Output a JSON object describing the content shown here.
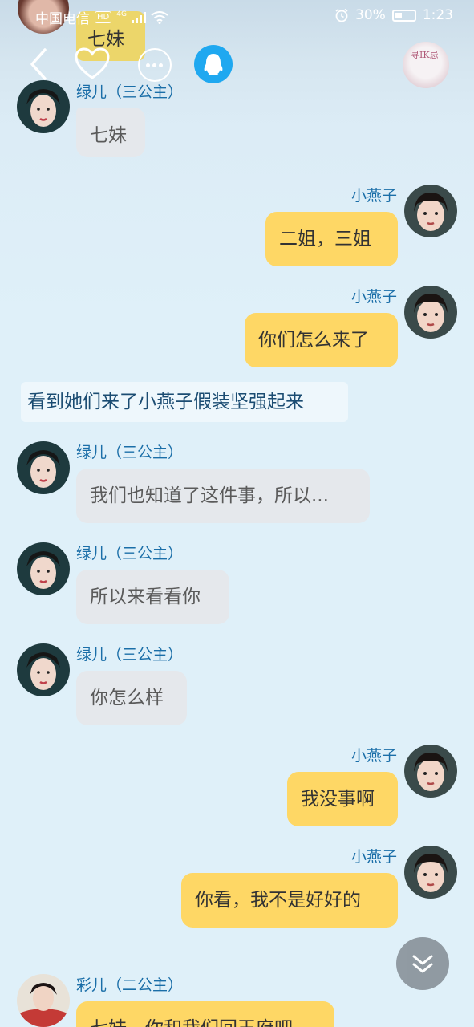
{
  "status_bar": {
    "carrier": "中国电信",
    "hd": "HD",
    "network": "4G",
    "battery": "30%",
    "time": "1:23"
  },
  "header": {
    "back_icon": "chevron-left-icon",
    "heart_icon": "heart-icon",
    "more_icon": "more-dots-icon",
    "qq_icon": "qq-penguin-icon",
    "top_avatar_text": "寻IK忌"
  },
  "colors": {
    "name": "#1a6ea8",
    "gray_bubble": "#e5e8ec",
    "yellow_bubble": "#fed765",
    "narration_text": "#1b4c72"
  },
  "partial_top": {
    "bubble_text": "七妹"
  },
  "messages": [
    {
      "side": "left",
      "name": "绿儿（三公主）",
      "text": "七妹"
    },
    {
      "side": "right",
      "name": "小燕子",
      "text": "二姐，三姐"
    },
    {
      "side": "right",
      "name": "小燕子",
      "text": "你们怎么来了"
    },
    {
      "side": "narration",
      "text": "看到她们来了小燕子假装坚强起来"
    },
    {
      "side": "left",
      "name": "绿儿（三公主）",
      "text": "我们也知道了这件事，所以..."
    },
    {
      "side": "left",
      "name": "绿儿（三公主）",
      "text": "所以来看看你"
    },
    {
      "side": "left",
      "name": "绿儿（三公主）",
      "text": "你怎么样"
    },
    {
      "side": "right",
      "name": "小燕子",
      "text": "我没事啊"
    },
    {
      "side": "right",
      "name": "小燕子",
      "text": "你看，我不是好好的"
    },
    {
      "side": "left",
      "name": "彩儿（二公主）",
      "text": "七妹，你和我们回王府吧"
    }
  ],
  "scroll_down_icon": "double-chevron-down-icon"
}
